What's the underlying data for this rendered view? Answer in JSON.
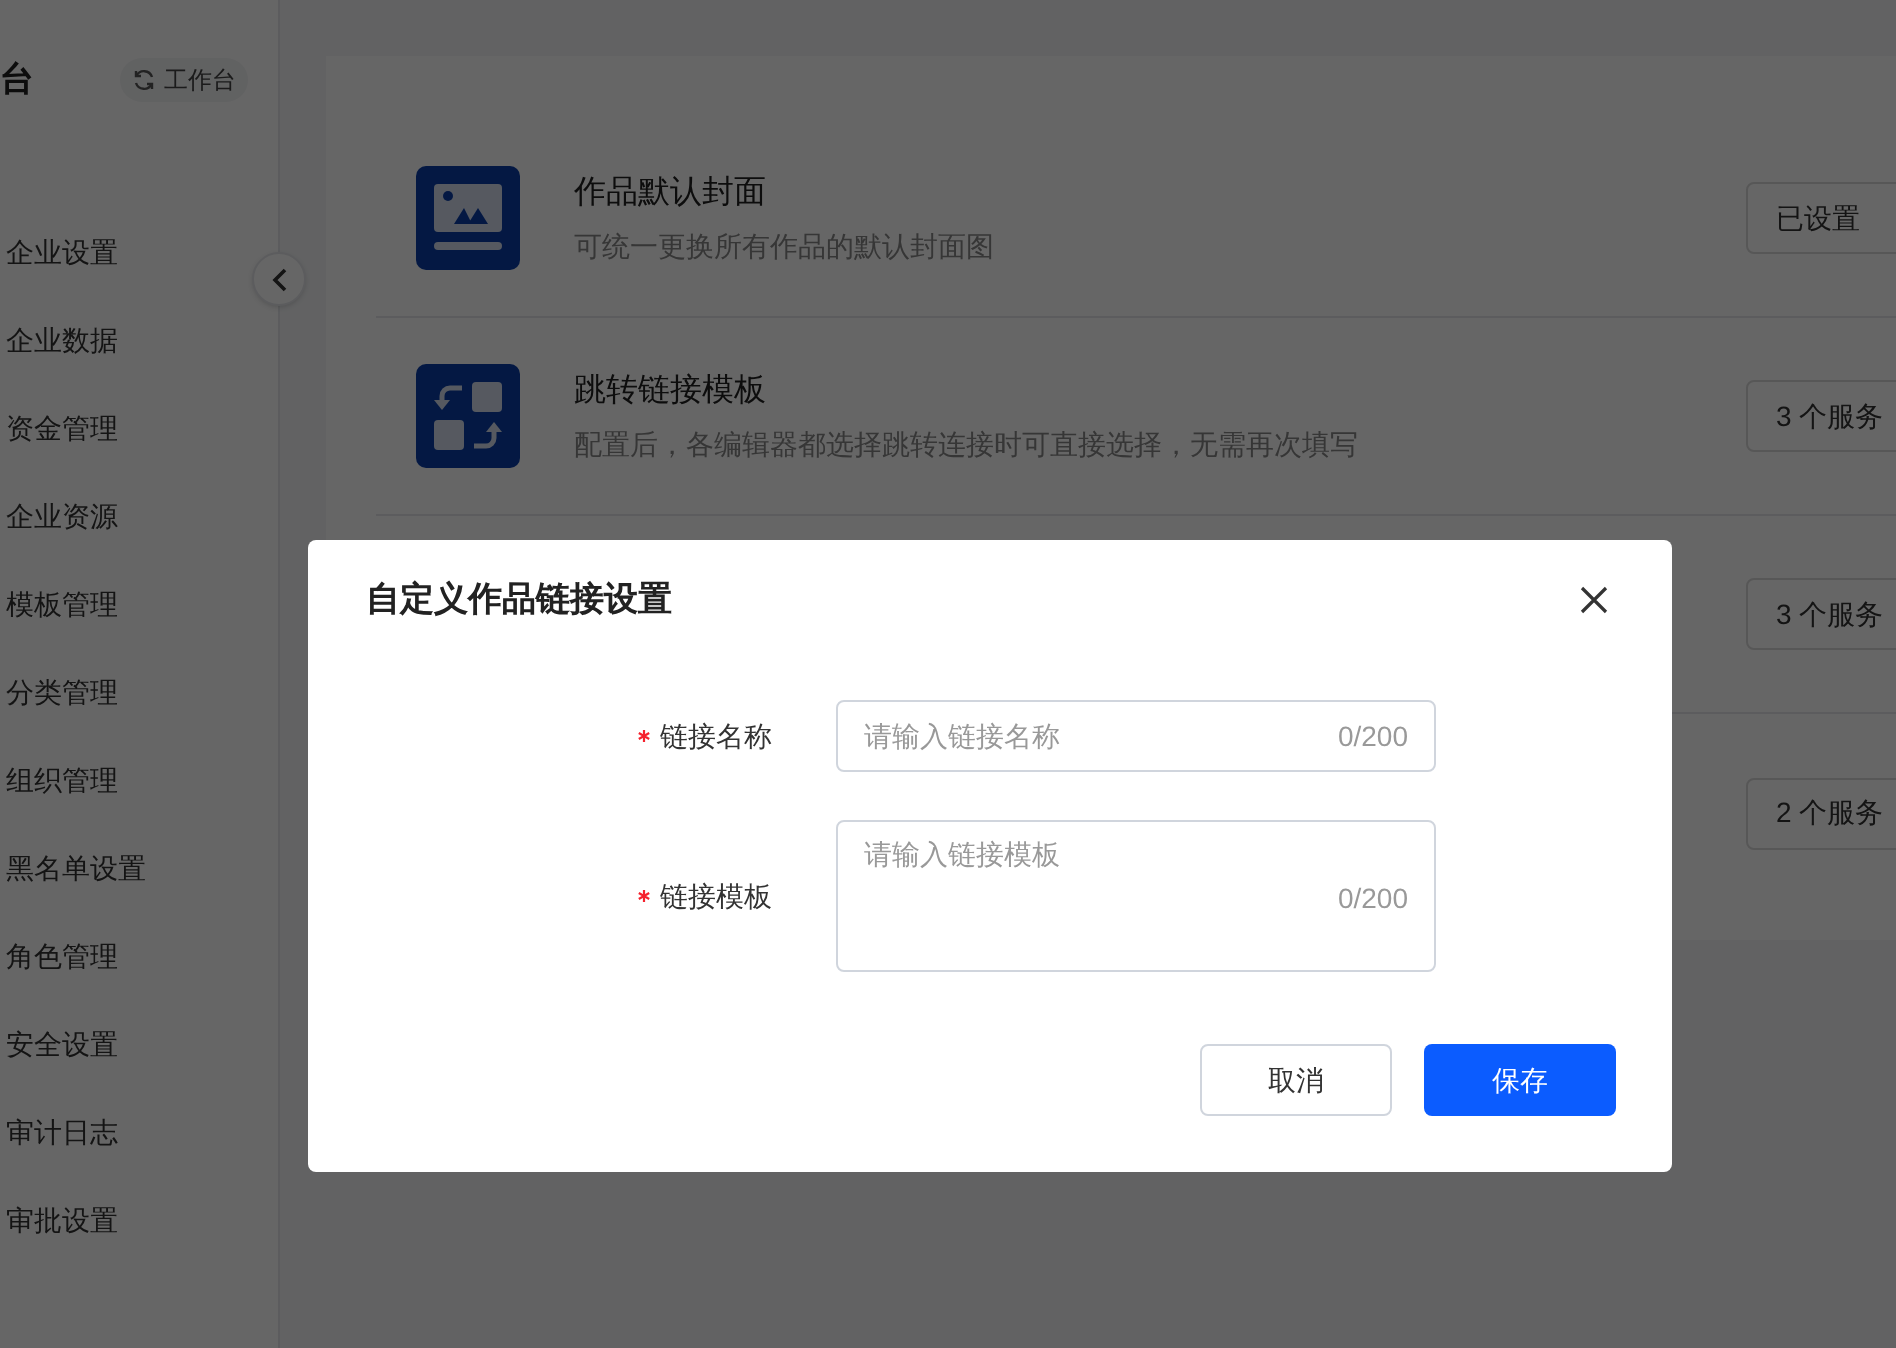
{
  "sidebar": {
    "title": "台",
    "workbench_button": "工作台",
    "items": [
      {
        "label": "企业设置"
      },
      {
        "label": "企业数据"
      },
      {
        "label": "资金管理"
      },
      {
        "label": "企业资源"
      },
      {
        "label": "模板管理"
      },
      {
        "label": "分类管理"
      },
      {
        "label": "组织管理"
      },
      {
        "label": "黑名单设置"
      },
      {
        "label": "角色管理"
      },
      {
        "label": "安全设置"
      },
      {
        "label": "审计日志"
      },
      {
        "label": "审批设置"
      }
    ]
  },
  "settings": [
    {
      "kind": "cover",
      "title": "作品默认封面",
      "description": "可统一更换所有作品的默认封面图",
      "action": "已设置"
    },
    {
      "kind": "link",
      "title": "跳转链接模板",
      "description": "配置后，各编辑器都选择跳转连接时可直接选择，无需再次填写",
      "action": "3 个服务"
    },
    {
      "kind": "hidden",
      "action": "3 个服务"
    },
    {
      "kind": "hidden",
      "action": "2 个服务"
    }
  ],
  "dialog": {
    "title": "自定义作品链接设置",
    "fields": [
      {
        "kind": "input",
        "label": "链接名称",
        "required": true,
        "placeholder": "请输入链接名称",
        "counter": "0/200"
      },
      {
        "kind": "textarea",
        "label": "链接模板",
        "required": true,
        "placeholder": "请输入链接模板",
        "counter": "0/200"
      }
    ],
    "buttons": [
      {
        "label": "取消",
        "primary": false
      },
      {
        "label": "保存",
        "primary": true
      }
    ]
  }
}
